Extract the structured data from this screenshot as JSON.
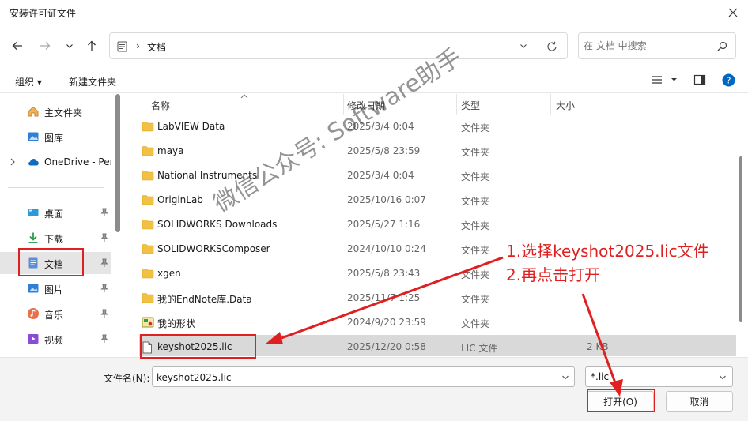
{
  "window": {
    "title": "安装许可证文件"
  },
  "address": {
    "crumb": "文档"
  },
  "search": {
    "placeholder": "在 文档 中搜索"
  },
  "toolbar": {
    "organize_label": "组织 ▾",
    "newfolder_label": "新建文件夹"
  },
  "sidebar": {
    "items": [
      {
        "label": "主文件夹",
        "icon": "home-icon"
      },
      {
        "label": "图库",
        "icon": "gallery-icon"
      },
      {
        "label": "OneDrive - Per",
        "icon": "cloud-icon"
      },
      {
        "label": "桌面",
        "icon": "desktop-icon"
      },
      {
        "label": "下载",
        "icon": "download-icon"
      },
      {
        "label": "文档",
        "icon": "document-icon"
      },
      {
        "label": "图片",
        "icon": "picture-icon"
      },
      {
        "label": "音乐",
        "icon": "music-icon"
      },
      {
        "label": "视频",
        "icon": "video-icon"
      }
    ]
  },
  "filelist": {
    "columns": [
      "名称",
      "修改日期",
      "类型",
      "大小"
    ],
    "rows": [
      {
        "name": "LabVIEW Data",
        "date": "2025/3/4 0:04",
        "type": "文件夹",
        "size": "",
        "icon": "folder-icon"
      },
      {
        "name": "maya",
        "date": "2025/5/8 23:59",
        "type": "文件夹",
        "size": "",
        "icon": "folder-icon"
      },
      {
        "name": "National Instruments",
        "date": "2025/3/4 0:04",
        "type": "文件夹",
        "size": "",
        "icon": "folder-icon"
      },
      {
        "name": "OriginLab",
        "date": "2025/10/16 0:07",
        "type": "文件夹",
        "size": "",
        "icon": "folder-icon"
      },
      {
        "name": "SOLIDWORKS Downloads",
        "date": "2025/5/27 1:16",
        "type": "文件夹",
        "size": "",
        "icon": "folder-icon"
      },
      {
        "name": "SOLIDWORKSComposer",
        "date": "2024/10/10 0:24",
        "type": "文件夹",
        "size": "",
        "icon": "folder-icon"
      },
      {
        "name": "xgen",
        "date": "2025/5/8 23:43",
        "type": "文件夹",
        "size": "",
        "icon": "folder-icon"
      },
      {
        "name": "我的EndNote库.Data",
        "date": "2025/11/7 1:25",
        "type": "文件夹",
        "size": "",
        "icon": "folder-icon"
      },
      {
        "name": "我的形状",
        "date": "2024/9/20 23:59",
        "type": "文件夹",
        "size": "",
        "icon": "shapes-folder-icon"
      },
      {
        "name": "keyshot2025.lic",
        "date": "2025/12/20 0:58",
        "type": "LIC 文件",
        "size": "2 KB",
        "icon": "file-icon"
      }
    ]
  },
  "bottom": {
    "filename_label": "文件名(N):",
    "filename_value": "keyshot2025.lic",
    "filter_value": "*.lic",
    "open_label": "打开(O)",
    "cancel_label": "取消"
  },
  "annotation": {
    "line1": "1.选择keyshot2025.lic文件",
    "line2": "2.再点击打开",
    "watermark": "微信公众号: Software助手"
  },
  "colors": {
    "accent": "#0067c0",
    "folder": "#f2c144",
    "annotation": "#e02020"
  }
}
